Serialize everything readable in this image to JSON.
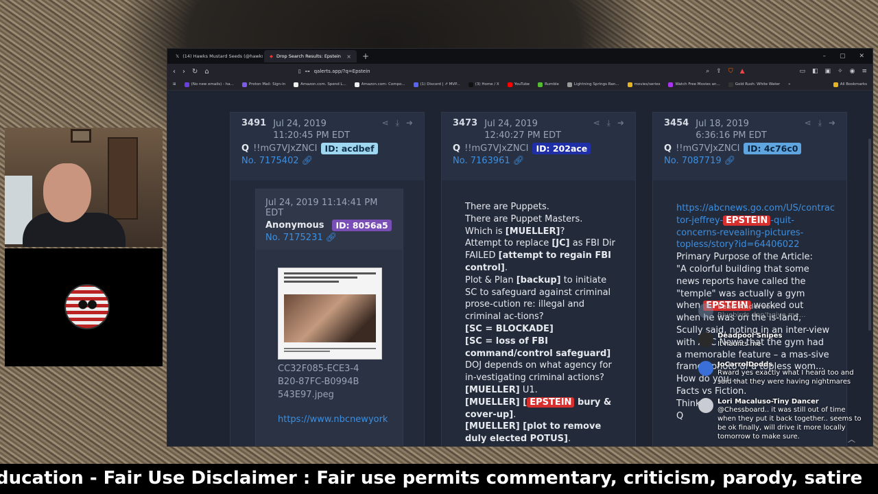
{
  "browser": {
    "tabs": [
      {
        "label": "(14) Hawks Mustard Seeds (@hawksmu...",
        "icon": "x-icon"
      },
      {
        "label": "Drop Search Results: Epstein",
        "icon": "q-icon"
      }
    ],
    "url": "qalerts.app/?q=Epstein",
    "bookmarks": [
      "(No new emails) - ha...",
      "Proton Mail: Sign-in",
      "Amazon.com. Spend L...",
      "Amazon.com: Compo...",
      "(1) Discord | ⇗ MVP...",
      "(3) Home / X",
      "YouTube",
      "Rumble",
      "Lightning Springs Ran...",
      "movies/series",
      "Watch Free Movies an...",
      "Gold Rush: White Water",
      "»",
      "All Bookmarks"
    ]
  },
  "cards": [
    {
      "number": "3491",
      "date": "Jul 24, 2019 11:20:45 PM EDT",
      "author": "Q",
      "trip": "!!mG7VJxZNCI",
      "id": "ID: acdbef",
      "id_bg": "#9fd6f0",
      "id_fg": "#12304a",
      "post_no": "No. 7175402",
      "quote": {
        "date": "Jul 24, 2019 11:14:41 PM EDT",
        "author": "Anonymous",
        "id": "ID: 8056a5",
        "id_bg": "#7a4fb5",
        "post_no": "No. 7175231",
        "filename": "CC32F085-ECE3-4B20-87FC-B0994B543E97.jpeg",
        "link": "https://www.nbcnewyork"
      }
    },
    {
      "number": "3473",
      "date": "Jul 24, 2019 12:40:27 PM EDT",
      "author": "Q",
      "trip": "!!mG7VJxZNCI",
      "id": "ID: 202ace",
      "id_bg": "#1f2fa8",
      "id_fg": "#ffffff",
      "post_no": "No. 7163961",
      "text": {
        "l1": "There are Puppets.",
        "l2": "There are Puppet Masters.",
        "l3a": "Which is ",
        "l3b": "[MUELLER]",
        "l3c": "?",
        "l4a": "Attempt to replace ",
        "l4b": "[JC]",
        "l4c": " as FBI Dir",
        "l5a": "FAILED ",
        "l5b": "[attempt to regain FBI control]",
        "l5c": ".",
        "l6a": "Plot & Plan ",
        "l6b": "[backup]",
        "l6c": " to initiate SC to safeguard against criminal prose-cution re: illegal and criminal ac-tions?",
        "l7": "[SC = BLOCKADE]",
        "l8": "[SC = loss of FBI command/control safeguard]",
        "l9": "DOJ depends on what agency for in-vestigating criminal actions?",
        "l10a": "[MUELLER]",
        "l10b": " U1.",
        "l11a": "[MUELLER] [",
        "l11b": "EPSTEIN",
        "l11c": " bury & cover-up]",
        "l11d": ".",
        "l12a": "[MUELLER] [plot to remove duly elected POTUS]",
        "l12b": "."
      }
    },
    {
      "number": "3454",
      "date": "Jul 18, 2019 6:36:16 PM EDT",
      "author": "Q",
      "trip": "!!mG7VJxZNCI",
      "id": "ID: 4c76c0",
      "id_bg": "#5fa6e0",
      "id_fg": "#0c2440",
      "post_no": "No. 7087719",
      "text": {
        "link_a": "https://abcnews.go.com/US/contrac tor-jeffrey-",
        "link_hl": "EPSTEIN",
        "link_b": "-quit-concerns-revealing-pictures-topless/story?id=64406022",
        "p1": "Primary Purpose of the Article:",
        "p2": "\"A colorful building that some news reports have called the \"temple\" was actually a gym when ",
        "p2_hl": "EPSTEIN",
        "p3": " worked out when he was on the is-land, Scully said, noting in an inter-view with ABC News that the gym had a memorable feature – a mas-sive framed photo of a topless wom...",
        "p4": "How do you ...",
        "p5": "Facts vs Fiction.",
        "p6": "Think ...",
        "p7": "Q"
      }
    }
  ],
  "chat": [
    {
      "name": "Lead Anderson",
      "text": "Bluebirds don't give me...",
      "faded": true
    },
    {
      "name": "Deadpool Snipes",
      "text": "It haunts me",
      "faded": false
    },
    {
      "name": "JoCarrolDodds",
      "text": "Rward yes exactly what I heard too and said that they were having nightmares",
      "faded": false
    },
    {
      "name": "Lori Macaluso-Tiny Dancer",
      "text": "@Chessboard.. it was still out of time when they put it back together.. seems to be ok finally, will drive it more locally tomorrow to make sure.",
      "faded": false
    }
  ],
  "ticker": "ducation - Fair Use Disclaimer : Fair use permits commentary, criticism, parody, satire"
}
